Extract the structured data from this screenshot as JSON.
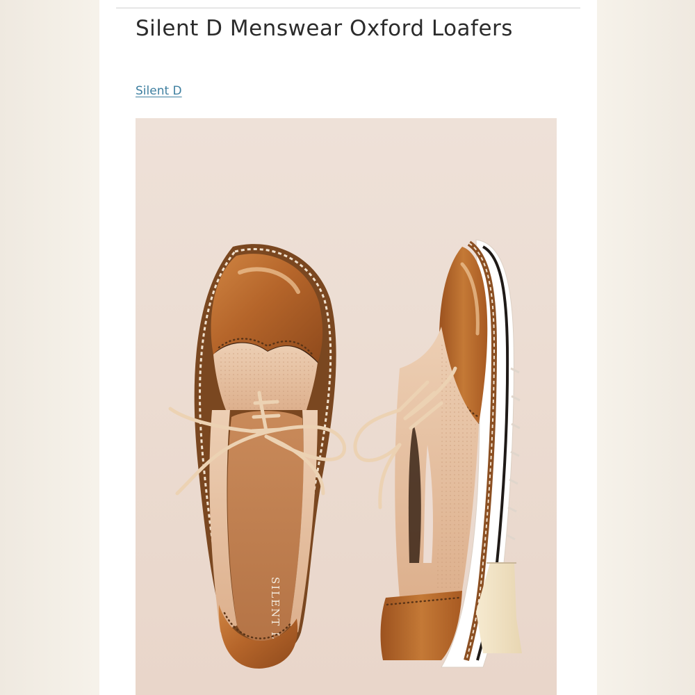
{
  "product": {
    "title": "Silent D Menswear Oxford Loafers",
    "brand": "Silent D",
    "insole_logo": "SILENT D",
    "image_alt": "Pair of tan and caramel patent leather lace-up oxford loafers with perforated panels and white lug soles"
  },
  "colors": {
    "background": "#f6f2ea",
    "card": "#ffffff",
    "title_text": "#2b2b2b",
    "link": "#3e7fa0",
    "photo_backdrop": "#eddcd2",
    "patent_leather": "#b9692c",
    "nude_leather": "#e7c2a3",
    "laces": "#ecd2b3",
    "sole": "#ffffff"
  }
}
